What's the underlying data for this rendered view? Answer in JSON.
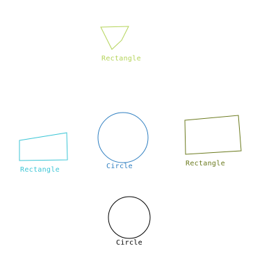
{
  "shapes": [
    {
      "type": "polygon",
      "label": "Rectangle",
      "color": "#b5d45a"
    },
    {
      "type": "circle",
      "label": "Circle",
      "color": "#2f7fc1"
    },
    {
      "type": "polygon",
      "label": "Rectangle",
      "color": "#3cc6d6"
    },
    {
      "type": "polygon",
      "label": "Rectangle",
      "color": "#6b7a1e"
    },
    {
      "type": "circle",
      "label": "Circle",
      "color": "#000000"
    }
  ]
}
